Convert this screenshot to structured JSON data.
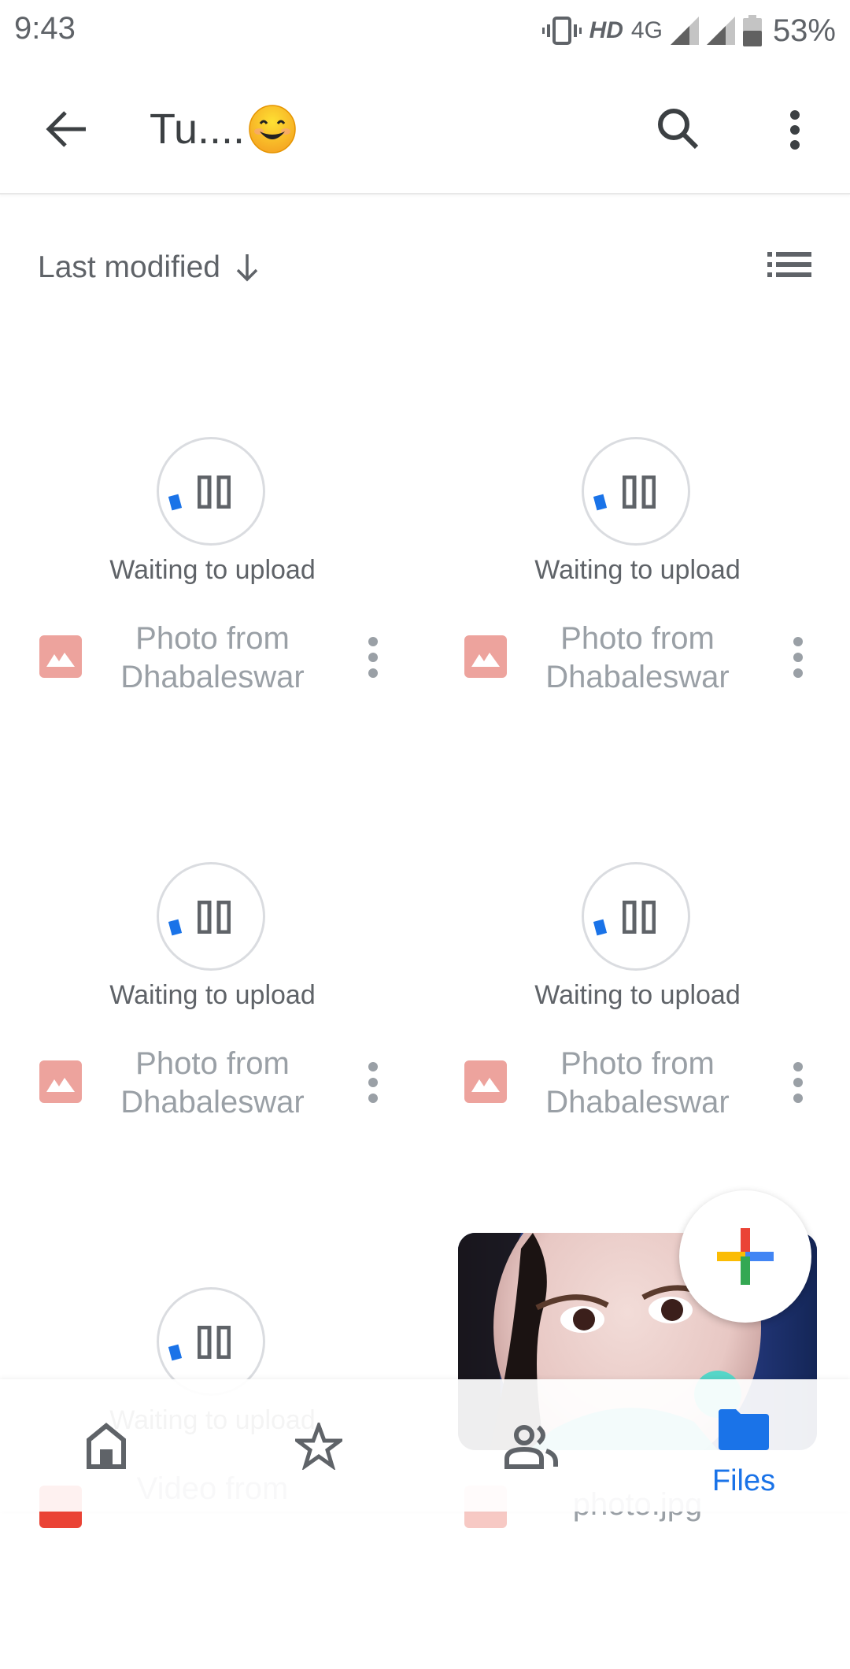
{
  "status_bar": {
    "time": "9:43",
    "hd": "HD",
    "network": "4G",
    "battery": "53%",
    "icons": [
      "vibrate-icon",
      "signal-icon",
      "signal-icon",
      "battery-icon"
    ]
  },
  "app_bar": {
    "title": "Tu....",
    "title_emoji": "smiling-face-icon",
    "back": "back-arrow-icon",
    "search": "search-icon",
    "more": "more-vert-icon"
  },
  "sort": {
    "label": "Last modified",
    "direction": "descending",
    "view_toggle": "list-view-icon"
  },
  "files": [
    {
      "status": "Waiting to upload",
      "name": "Photo from Dhabaleswar",
      "type": "image"
    },
    {
      "status": "Waiting to upload",
      "name": "Photo from Dhabaleswar",
      "type": "image"
    },
    {
      "status": "Waiting to upload",
      "name": "Photo from Dhabaleswar",
      "type": "image"
    },
    {
      "status": "Waiting to upload",
      "name": "Photo from Dhabaleswar",
      "type": "image"
    },
    {
      "status": "Waiting to upload",
      "name": "Video from",
      "type": "video"
    },
    {
      "status": "",
      "name": "photo.jpg",
      "type": "image"
    }
  ],
  "fab": {
    "label": "New",
    "icon": "google-plus-icon"
  },
  "bottom_nav": {
    "items": [
      {
        "name": "home",
        "label": "Home",
        "icon": "home-icon",
        "active": false
      },
      {
        "name": "starred",
        "label": "Starred",
        "icon": "star-icon",
        "active": false
      },
      {
        "name": "shared",
        "label": "Shared",
        "icon": "people-icon",
        "active": false
      },
      {
        "name": "files",
        "label": "Files",
        "icon": "folder-icon",
        "active": true
      }
    ]
  },
  "colors": {
    "accent": "#1a73e8",
    "text_primary": "#3c4043",
    "text_secondary": "#5f6368",
    "text_disabled": "#9aa0a6",
    "image_icon": "#eda39d",
    "fab_red": "#ea4335",
    "fab_yellow": "#fbbc04",
    "fab_blue": "#4285f4",
    "fab_green": "#34a853"
  }
}
